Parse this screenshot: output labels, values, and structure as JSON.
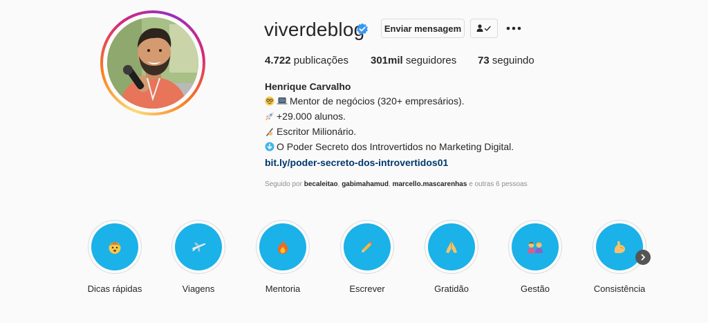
{
  "profile": {
    "username": "viverdeblog",
    "send_message_label": "Enviar mensagem",
    "stats": {
      "posts_count": "4.722",
      "posts_label": "publicações",
      "followers_count": "301mil",
      "followers_label": "seguidores",
      "following_count": "73",
      "following_label": "seguindo"
    },
    "bio": {
      "name": "Henrique Carvalho",
      "line1": "Mentor de negócios (320+ empresários).",
      "line2": "+29.000 alunos.",
      "line3": "Escritor Milionário.",
      "line4": "O Poder Secreto dos Introvertidos no Marketing Digital.",
      "link": "bit.ly/poder-secreto-dos-introvertidos01"
    },
    "followed_by": {
      "prefix": "Seguido por",
      "users": [
        "becaleitao",
        "gabimahamud",
        "marcello.mascarenhas"
      ],
      "suffix": "e outras 6 pessoas"
    }
  },
  "highlights": [
    {
      "label": "Dicas rápidas",
      "icon": "mind-blown-emoji-icon"
    },
    {
      "label": "Viagens",
      "icon": "airplane-icon"
    },
    {
      "label": "Mentoria",
      "icon": "fire-icon"
    },
    {
      "label": "Escrever",
      "icon": "pencil-icon"
    },
    {
      "label": "Gratidão",
      "icon": "praying-hands-icon"
    },
    {
      "label": "Gestão",
      "icon": "people-bowing-icon"
    },
    {
      "label": "Consistência",
      "icon": "flexed-biceps-icon"
    }
  ],
  "colors": {
    "highlight_bg": "#1ab2e8",
    "link": "#00376b",
    "verified": "#3897f0"
  }
}
